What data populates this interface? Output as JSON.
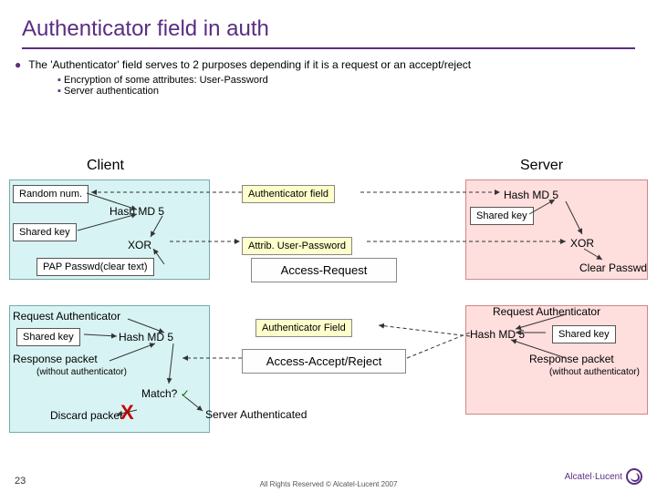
{
  "title": "Authenticator field in auth",
  "bullet_main": "The 'Authenticator' field serves to 2 purposes depending if it is a request or an accept/reject",
  "sub1": "Encryption of some attributes: User-Password",
  "sub2": "Server authentication",
  "client_hdr": "Client",
  "server_hdr": "Server",
  "random_num": "Random num.",
  "hash_md5": "Hash MD 5",
  "shared_key": "Shared key",
  "xor": "XOR",
  "pap": "PAP Passwd(clear text)",
  "auth_field1": "Authenticator field",
  "attrib": "Attrib. User-Password",
  "access_request": "Access-Request",
  "clear_passwd": "Clear Passwd",
  "req_auth": "Request Authenticator",
  "auth_field2": "Authenticator Field",
  "resp_pkt": "Response packet",
  "without_auth": "(without authenticator)",
  "access_accept": "Access-Accept/Reject",
  "discard": "Discard packet",
  "match": "Match?",
  "server_auth": "Server Authenticated",
  "pagenum": "23",
  "footer": "All Rights Reserved © Alcatel-Lucent 2007",
  "logo": "Alcatel·Lucent"
}
